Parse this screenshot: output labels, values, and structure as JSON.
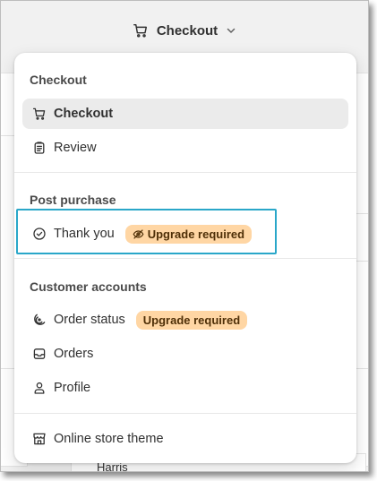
{
  "topbar": {
    "title": "Checkout"
  },
  "menu": {
    "sections": [
      {
        "title": "Checkout",
        "items": [
          {
            "label": "Checkout",
            "icon": "cart-icon",
            "active": true
          },
          {
            "label": "Review",
            "icon": "clipboard-icon"
          }
        ]
      },
      {
        "title": "Post purchase",
        "items": [
          {
            "label": "Thank you",
            "icon": "check-circle-icon",
            "badge": "Upgrade required",
            "badge_icon": "eye-off-icon"
          }
        ]
      },
      {
        "title": "Customer accounts",
        "items": [
          {
            "label": "Order status",
            "icon": "order-status-icon",
            "badge": "Upgrade required"
          },
          {
            "label": "Orders",
            "icon": "inbox-icon"
          },
          {
            "label": "Profile",
            "icon": "person-icon"
          }
        ]
      },
      {
        "title": "",
        "items": [
          {
            "label": "Online store theme",
            "icon": "store-icon"
          }
        ]
      }
    ]
  },
  "background": {
    "partial_text": "Harris"
  },
  "colors": {
    "badge_bg": "#ffd6a4",
    "badge_text": "#4f2f07",
    "highlight": "#2aa7c9",
    "active_item_bg": "#ebebeb"
  }
}
